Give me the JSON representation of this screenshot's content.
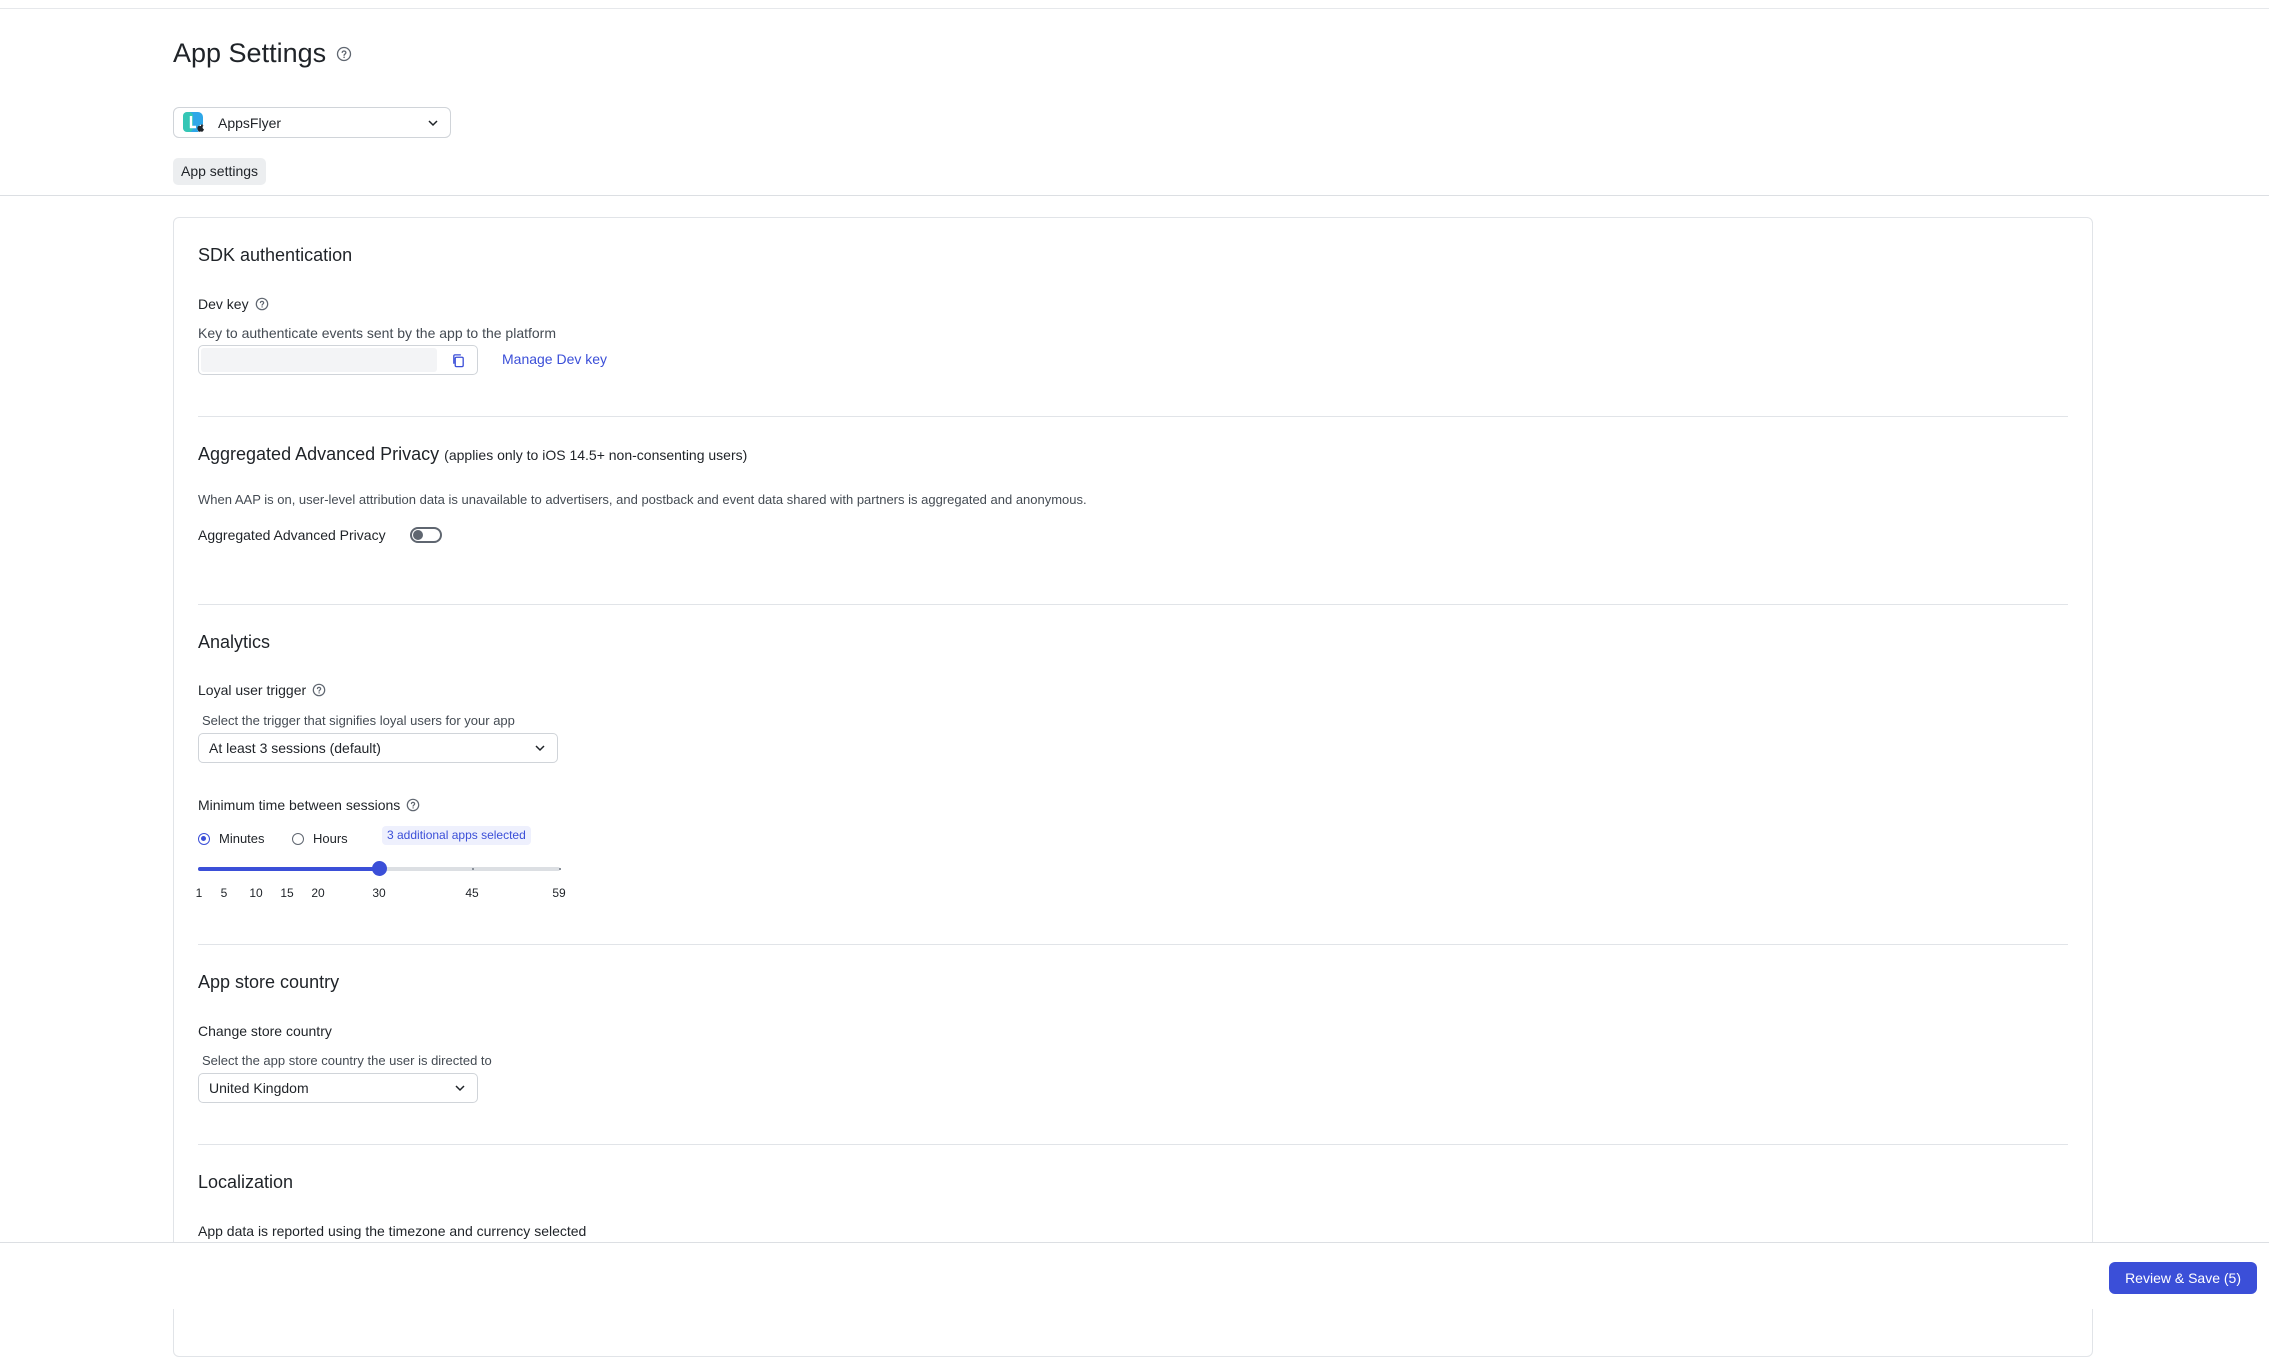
{
  "header": {
    "title": "App Settings",
    "app_selector": {
      "value": "AppsFlyer"
    },
    "tabs": [
      {
        "label": "App settings"
      }
    ]
  },
  "sdk": {
    "title": "SDK authentication",
    "dev_key_label": "Dev key",
    "dev_key_hint": "Key to authenticate events sent by the app to the platform",
    "manage_link": "Manage Dev key"
  },
  "aap": {
    "title": "Aggregated Advanced Privacy",
    "title_note": "(applies only to iOS 14.5+ non-consenting users)",
    "description": "When AAP is on, user-level attribution data is unavailable to advertisers, and postback and event data shared with partners is aggregated and anonymous.",
    "toggle_label": "Aggregated Advanced Privacy",
    "toggle_on": false
  },
  "analytics": {
    "title": "Analytics",
    "loyal_label": "Loyal user trigger",
    "loyal_hint": "Select the trigger that signifies loyal users for your app",
    "loyal_value": "At least 3 sessions (default)",
    "min_time_label": "Minimum time between sessions",
    "unit_minutes": "Minutes",
    "unit_hours": "Hours",
    "selected_unit": "Minutes",
    "badge": "3 additional apps selected",
    "slider": {
      "min": 1,
      "max": 59,
      "value": 30,
      "ticks": [
        "1",
        "5",
        "10",
        "15",
        "20",
        "30",
        "45",
        "59"
      ]
    }
  },
  "store": {
    "title": "App store country",
    "label": "Change store country",
    "hint": "Select the app store country the user is directed to",
    "value": "United Kingdom"
  },
  "localization": {
    "title": "Localization",
    "hint": "App data is reported using the timezone and currency selected"
  },
  "footer": {
    "save_label": "Review & Save (5)"
  },
  "colors": {
    "accent": "#3b4fd8",
    "border": "#d0d4d9",
    "text": "#1f2328"
  }
}
